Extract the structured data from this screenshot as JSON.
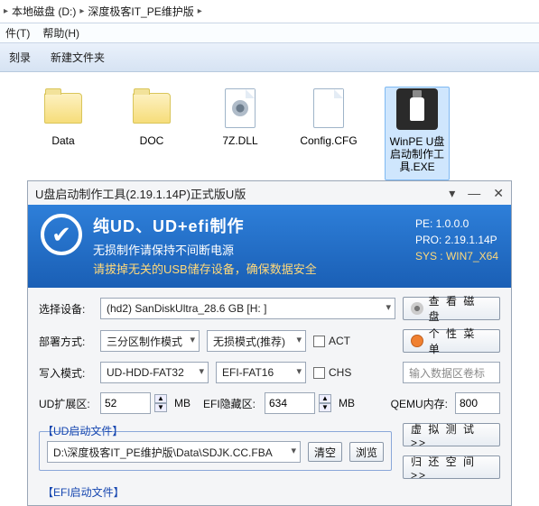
{
  "explorer": {
    "breadcrumb": [
      "本地磁盘 (D:)",
      "深度极客IT_PE维护版"
    ],
    "menu": [
      "件(T)",
      "帮助(H)"
    ],
    "toolbar": [
      "刻录",
      "新建文件夹"
    ],
    "files": [
      {
        "label": "Data",
        "type": "folder"
      },
      {
        "label": "DOC",
        "type": "folder"
      },
      {
        "label": "7Z.DLL",
        "type": "page-gear"
      },
      {
        "label": "Config.CFG",
        "type": "page"
      },
      {
        "label": "WinPE U盘启动制作工具.EXE",
        "type": "winpe",
        "selected": true
      }
    ]
  },
  "app": {
    "title": "U盘启动制作工具(2.19.1.14P)正式版U版",
    "banner": {
      "line1": "纯UD、UD+efi制作",
      "line2": "无损制作请保持不间断电源",
      "line3": "请拔掉无关的USB储存设备，确保数据安全",
      "pe": "PE: 1.0.0.0",
      "pro": "PRO: 2.19.1.14P",
      "sys": "SYS : WIN7_X64"
    },
    "labels": {
      "device": "选择设备:",
      "deploy": "部署方式:",
      "write": "写入模式:",
      "udext": "UD扩展区:",
      "efihide": "EFI隐藏区:",
      "qemu": "QEMU内存:",
      "ud_group": "【UD启动文件】",
      "efi_group": "【EFI启动文件】",
      "mb": "MB"
    },
    "values": {
      "device": "(hd2) SanDiskUltra_28.6 GB [H: ]",
      "deploy": "三分区制作模式",
      "lossless": "无损模式(推荐)",
      "act": "ACT",
      "write_ud": "UD-HDD-FAT32",
      "write_efi": "EFI-FAT16",
      "chs": "CHS",
      "udext": "52",
      "efihide": "634",
      "qemu": "800",
      "udpath": "D:\\深度极客IT_PE维护版\\Data\\SDJK.CC.FBA"
    },
    "buttons": {
      "view_disk": "查 看 磁 盘",
      "personal": "个 性 菜 单",
      "input_label": "输入数据区卷标",
      "virtual_test": "虚 拟 测 试  >>",
      "return_space": "归 还 空 间  >>",
      "clear": "清空",
      "browse": "浏览"
    }
  }
}
